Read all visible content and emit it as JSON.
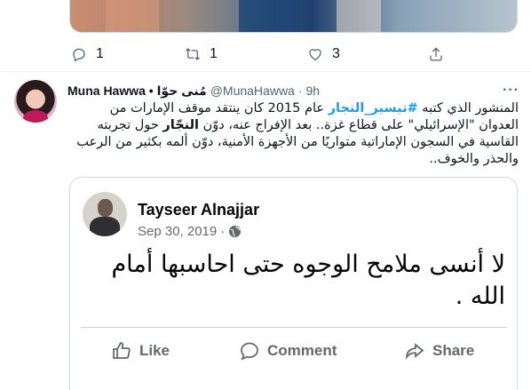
{
  "previous_tweet": {
    "actions": [
      {
        "icon": "reply-icon",
        "count": "1"
      },
      {
        "icon": "retweet-icon",
        "count": "1"
      },
      {
        "icon": "like-icon",
        "count": "3"
      },
      {
        "icon": "share-icon",
        "count": ""
      }
    ]
  },
  "tweet": {
    "author_name": "Muna Hawwa • مُنى حوّا",
    "handle": "@MunaHawwa",
    "separator": "·",
    "time": "9h",
    "more": "···",
    "text_parts": [
      {
        "text": "المنشور الذي كتبه ",
        "style": "normal"
      },
      {
        "text": "#تيسير_النجار",
        "style": "hashtag"
      },
      {
        "text": " عام 2015 كان ينتقد موقف الإمارات من العدوان \"الإسرائيلي\" على قطاع غزة.. بعد الإفراج عنه، دوّن ",
        "style": "normal"
      },
      {
        "text": "النجّار",
        "style": "bold"
      },
      {
        "text": " حول تجربته القاسية في السجون الإماراتية متواريًا من الأجهزة الأمنية، دوّن ألمه بكثير من الرعب والحذر والخوف..",
        "style": "normal"
      }
    ]
  },
  "embedded_post": {
    "author": "Tayseer Alnajjar",
    "date": "Sep 30, 2019",
    "meta_separator": "·",
    "privacy_icon": "globe-icon",
    "body": "لا أنسى ملامح الوجوه حتى احاسبها أمام الله .",
    "actions": [
      {
        "icon": "thumbs-up-icon",
        "label": "Like"
      },
      {
        "icon": "comment-icon",
        "label": "Comment"
      },
      {
        "icon": "share-arrow-icon",
        "label": "Share"
      }
    ]
  }
}
